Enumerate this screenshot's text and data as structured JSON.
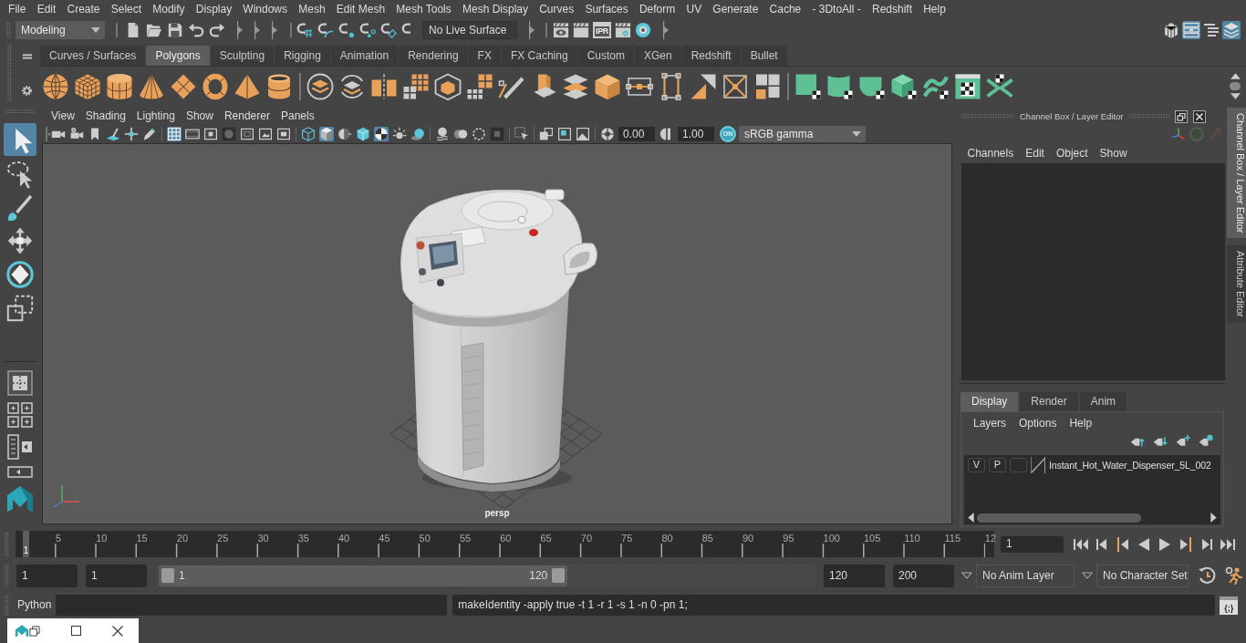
{
  "menu_bar": {
    "items": [
      "File",
      "Edit",
      "Create",
      "Select",
      "Modify",
      "Display",
      "Windows",
      "Mesh",
      "Edit Mesh",
      "Mesh Tools",
      "Mesh Display",
      "Curves",
      "Surfaces",
      "Deform",
      "UV",
      "Generate",
      "Cache",
      "- 3DtoAll -",
      "Redshift",
      "Help"
    ]
  },
  "status_line": {
    "menu_set": "Modeling",
    "live_surface": "No Live Surface",
    "ipr_label": "IPR",
    "panel_toggles": [
      {
        "selected": false
      },
      {
        "selected": true
      },
      {
        "selected": false
      },
      {
        "selected": true
      }
    ]
  },
  "shelf": {
    "tabs": [
      {
        "label": "Curves / Surfaces",
        "selected": false
      },
      {
        "label": "Polygons",
        "selected": true
      },
      {
        "label": "Sculpting",
        "selected": false
      },
      {
        "label": "Rigging",
        "selected": false
      },
      {
        "label": "Animation",
        "selected": false
      },
      {
        "label": "Rendering",
        "selected": false
      },
      {
        "label": "FX",
        "selected": false
      },
      {
        "label": "FX Caching",
        "selected": false
      },
      {
        "label": "Custom",
        "selected": false
      },
      {
        "label": "XGen",
        "selected": false
      },
      {
        "label": "Redshift",
        "selected": false
      },
      {
        "label": "Bullet",
        "selected": false
      }
    ]
  },
  "toolbox": {
    "tools": [
      {
        "selected": true
      },
      {
        "selected": false
      },
      {
        "selected": false
      },
      {
        "selected": false
      },
      {
        "selected": false
      },
      {
        "selected": false
      }
    ]
  },
  "viewport": {
    "menu": [
      "View",
      "Shading",
      "Lighting",
      "Show",
      "Renderer",
      "Panels"
    ],
    "toolbar": {
      "buttons": [
        {
          "selected": false
        },
        {
          "selected": false
        },
        {
          "selected": false
        },
        {
          "selected": false
        },
        {
          "selected": false
        },
        {
          "selected": false
        },
        {
          "selected": true
        },
        {
          "selected": false
        },
        {
          "selected": false
        },
        {
          "selected": false
        },
        {
          "selected": false
        },
        {
          "selected": false
        },
        {
          "selected": false
        },
        {
          "selected": false
        },
        {
          "selected": true
        },
        {
          "selected": false
        },
        {
          "selected": false
        },
        {
          "selected": true
        },
        {
          "selected": false
        },
        {
          "selected": false
        },
        {
          "selected": false
        },
        {
          "selected": false
        },
        {
          "selected": false
        },
        {
          "selected": false
        },
        {
          "selected": false
        },
        {
          "selected": false
        },
        {
          "selected": false
        },
        {
          "selected": false
        }
      ],
      "exposure": "0.00",
      "gamma": "1.00",
      "color_management": {
        "label": "ON",
        "on": true
      },
      "view_transform": "sRGB gamma"
    },
    "camera": "persp"
  },
  "channel_box": {
    "title": "Channel Box / Layer Editor",
    "menu": [
      "Channels",
      "Edit",
      "Object",
      "Show"
    ]
  },
  "layer_editor": {
    "tabs": [
      {
        "label": "Display",
        "selected": true
      },
      {
        "label": "Render",
        "selected": false
      },
      {
        "label": "Anim",
        "selected": false
      }
    ],
    "menu": [
      "Layers",
      "Options",
      "Help"
    ],
    "layers": [
      {
        "visible": "V",
        "playback": "P",
        "name": "Instant_Hot_Water_Dispenser_5L_002"
      }
    ]
  },
  "side_tabs": [
    {
      "label": "Channel Box / Layer Editor",
      "selected": true
    },
    {
      "label": "Attribute Editor",
      "selected": false
    }
  ],
  "time_slider": {
    "ticks": [
      "5",
      "10",
      "15",
      "20",
      "25",
      "30",
      "35",
      "40",
      "45",
      "50",
      "55",
      "60",
      "65",
      "70",
      "75",
      "80",
      "85",
      "90",
      "95",
      "100",
      "105",
      "110",
      "115",
      "12"
    ],
    "current_frame_marker": "1",
    "level": 0,
    "current_frame": "1"
  },
  "range_slider": {
    "animation_start": "1",
    "playback_start": "1",
    "range_start_label": "1",
    "range_end_label": "120",
    "level": 0.62,
    "playback_end": "120",
    "animation_end": "200",
    "anim_layer": "No Anim Layer",
    "character_set": "No Character Set"
  },
  "command_line": {
    "language": "Python",
    "result": "makeIdentity -apply true -t 1 -r 1 -s 1 -n 0 -pn 1;",
    "script_editor_glyph": "{;}"
  }
}
